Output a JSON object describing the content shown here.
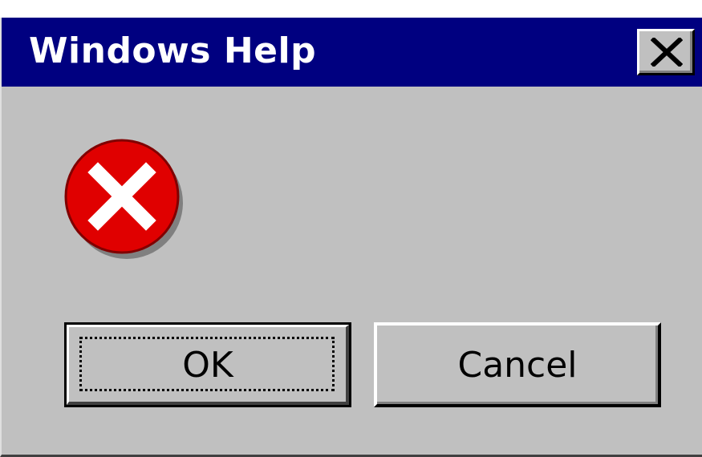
{
  "window": {
    "title": "Windows Help",
    "close_icon": "close-icon"
  },
  "message": {
    "icon": "error-icon",
    "text": ""
  },
  "buttons": {
    "ok_label": "OK",
    "cancel_label": "Cancel"
  },
  "colors": {
    "titlebar": "#000080",
    "face": "#c0c0c0",
    "error_red": "#e00000"
  }
}
